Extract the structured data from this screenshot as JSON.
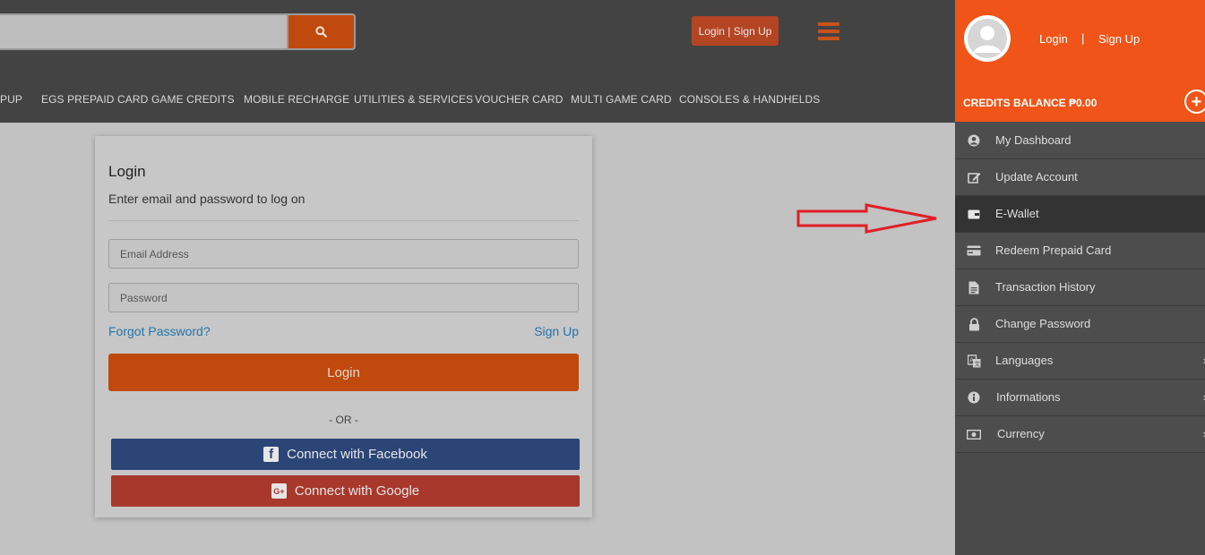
{
  "header": {
    "search_placeholder": "",
    "login_signup_label": "Login | Sign Up",
    "nav": [
      "PUP",
      "EGS PREPAID CARD",
      "GAME CREDITS",
      "MOBILE RECHARGE",
      "UTILITIES & SERVICES",
      "VOUCHER CARD",
      "MULTI GAME CARD",
      "CONSOLES & HANDHELDS"
    ]
  },
  "login_card": {
    "title": "Login",
    "subtitle": "Enter email and password to log on",
    "email_placeholder": "Email Address",
    "password_placeholder": "Password",
    "forgot_password": "Forgot Password?",
    "sign_up": "Sign Up",
    "login_button": "Login",
    "or": "- OR -",
    "facebook": "Connect with Facebook",
    "google": "Connect with Google"
  },
  "drawer": {
    "login": "Login",
    "separator": "|",
    "sign_up": "Sign Up",
    "credits_balance": "CREDITS BALANCE ₱0.00",
    "menu": [
      {
        "label": "My Dashboard",
        "icon": "user-circle-icon"
      },
      {
        "label": "Update Account",
        "icon": "edit-icon"
      },
      {
        "label": "E-Wallet",
        "icon": "wallet-icon"
      },
      {
        "label": "Redeem Prepaid Card",
        "icon": "credit-card-icon"
      },
      {
        "label": "Transaction History",
        "icon": "document-icon"
      },
      {
        "label": "Change Password",
        "icon": "lock-icon"
      },
      {
        "label": "Languages",
        "icon": "translate-icon"
      },
      {
        "label": "Informations",
        "icon": "info-icon"
      },
      {
        "label": "Currency",
        "icon": "money-icon"
      }
    ],
    "active_item": "E-Wallet"
  },
  "colors": {
    "accent": "#f05418",
    "button": "#c04a0d",
    "header_bg": "#434343",
    "drawer_bg": "#4d4d4d",
    "arrow": "#e01f26"
  }
}
